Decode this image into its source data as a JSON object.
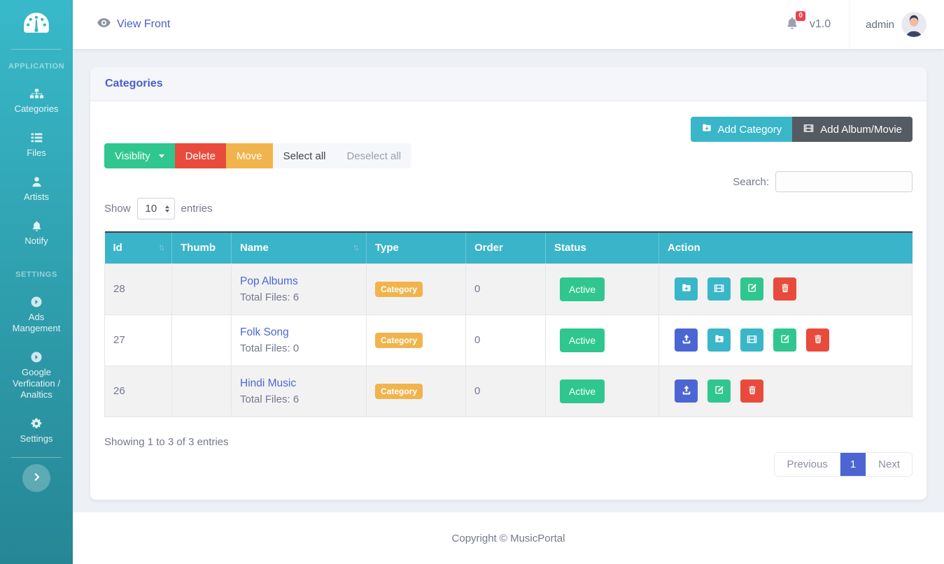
{
  "app": {
    "version": "v1.0",
    "user": "admin",
    "logo_icon": "gauge-icon",
    "avatar_icon": "user-avatar"
  },
  "header": {
    "view_front": "View Front",
    "view_front_icon": "eye-icon",
    "bell_icon": "bell-icon",
    "notification_count": "0"
  },
  "sidebar": {
    "section_application": "APPLICATION",
    "section_settings": "SETTINGS",
    "app_items": [
      {
        "label": "Categories",
        "icon": "sitemap-icon"
      },
      {
        "label": "Files",
        "icon": "list-icon"
      },
      {
        "label": "Artists",
        "icon": "user-icon"
      },
      {
        "label": "Notify",
        "icon": "bell-icon"
      }
    ],
    "settings_items": [
      {
        "label": "Ads Mangement",
        "icon": "arrow-circle-right-icon"
      },
      {
        "label": "Google Verfication / Analtics",
        "icon": "arrow-circle-right-icon"
      },
      {
        "label": "Settings",
        "icon": "gear-icon"
      }
    ],
    "toggle_icon": "chevron-right-icon"
  },
  "card": {
    "title": "Categories",
    "add_category": "Add Category",
    "add_category_icon": "folder-plus-icon",
    "add_album": "Add Album/Movie",
    "add_album_icon": "film-icon",
    "toolbar": {
      "visibility": "Visiblity",
      "delete": "Delete",
      "move": "Move",
      "select_all": "Select all",
      "deselect_all": "Deselect all"
    },
    "search_label": "Search:",
    "search_value": "",
    "show_label": "Show",
    "page_length": "10",
    "entries_label": "entries",
    "info": "Showing 1 to 3 of 3 entries",
    "pagination": {
      "previous": "Previous",
      "page": "1",
      "next": "Next"
    }
  },
  "table": {
    "columns": [
      {
        "label": "Id",
        "sortable": true
      },
      {
        "label": "Thumb",
        "sortable": false
      },
      {
        "label": "Name",
        "sortable": true
      },
      {
        "label": "Type",
        "sortable": false
      },
      {
        "label": "Order",
        "sortable": false
      },
      {
        "label": "Status",
        "sortable": false
      },
      {
        "label": "Action",
        "sortable": false
      }
    ],
    "rows": [
      {
        "id": "28",
        "name": "Pop Albums",
        "files": "Total Files: 6",
        "type": "Category",
        "order": "0",
        "status": "Active",
        "actions": [
          "folder-plus-icon",
          "film-icon",
          "edit-icon",
          "trash-icon"
        ]
      },
      {
        "id": "27",
        "name": "Folk Song",
        "files": "Total Files: 0",
        "type": "Category",
        "order": "0",
        "status": "Active",
        "actions": [
          "upload-icon",
          "folder-plus-icon",
          "film-icon",
          "edit-icon",
          "trash-icon"
        ]
      },
      {
        "id": "26",
        "name": "Hindi Music",
        "files": "Total Files: 6",
        "type": "Category",
        "order": "0",
        "status": "Active",
        "actions": [
          "upload-icon",
          "edit-icon",
          "trash-icon"
        ]
      }
    ]
  },
  "footer": {
    "copyright": "Copyright © MusicPortal"
  },
  "colors": {
    "teal": "#3ab6c9",
    "sidebar_top": "#38b9c9",
    "sidebar_bottom": "#268694",
    "primary_blue": "#4b66d2",
    "link_blue": "#4a5ec9",
    "success_green": "#2fc78f",
    "danger_red": "#e84b3c",
    "warning_yellow": "#f1b44c",
    "dark_button": "#545b62",
    "muted_text": "#74788d",
    "badge_red": "#ee4150"
  }
}
